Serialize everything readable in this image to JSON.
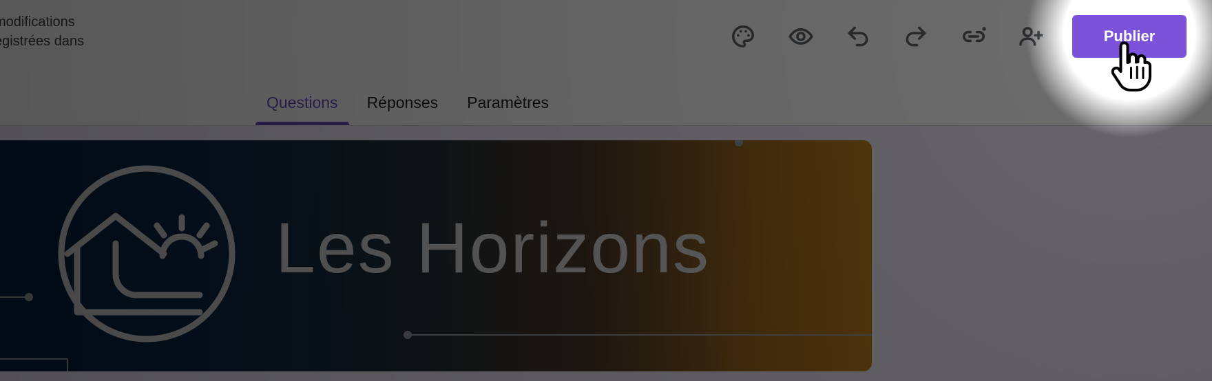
{
  "header": {
    "save_status_line1": "modifications",
    "save_status_line2": "egistrées dans",
    "publish_label": "Publier"
  },
  "toolbar": {
    "icons": [
      "palette-icon",
      "eye-icon",
      "undo-icon",
      "redo-icon",
      "link-icon",
      "add-person-icon"
    ]
  },
  "tabs": [
    {
      "label": "Questions",
      "active": true
    },
    {
      "label": "Réponses",
      "active": false
    },
    {
      "label": "Paramètres",
      "active": false
    }
  ],
  "banner": {
    "title": "Les Horizons"
  },
  "colors": {
    "accent": "#7b52d9",
    "tab_active": "#6c4dc4",
    "background": "#f0ebf8"
  }
}
